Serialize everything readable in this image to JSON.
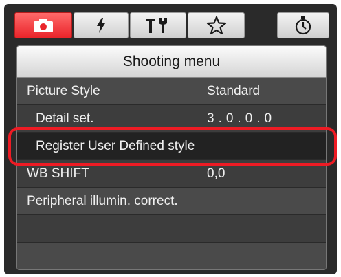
{
  "tabs": [
    {
      "icon": "camera-icon",
      "active": true
    },
    {
      "icon": "lightning-icon",
      "active": false
    },
    {
      "icon": "tools-icon",
      "active": false
    },
    {
      "icon": "star-icon",
      "active": false
    },
    {
      "icon": "stopwatch-icon",
      "active": false
    }
  ],
  "menu": {
    "title": "Shooting menu",
    "items": [
      {
        "label": "Picture Style",
        "value": "Standard"
      },
      {
        "label": "Detail set.",
        "value": "3.0.0.0"
      },
      {
        "label": "Register User Defined style",
        "value": ""
      },
      {
        "label": "WB SHIFT",
        "value": "0,0"
      },
      {
        "label": "Peripheral illumin. correct.",
        "value": ""
      }
    ]
  },
  "colors": {
    "active_tab": "#e9242a",
    "highlight": "#ee1b24"
  }
}
